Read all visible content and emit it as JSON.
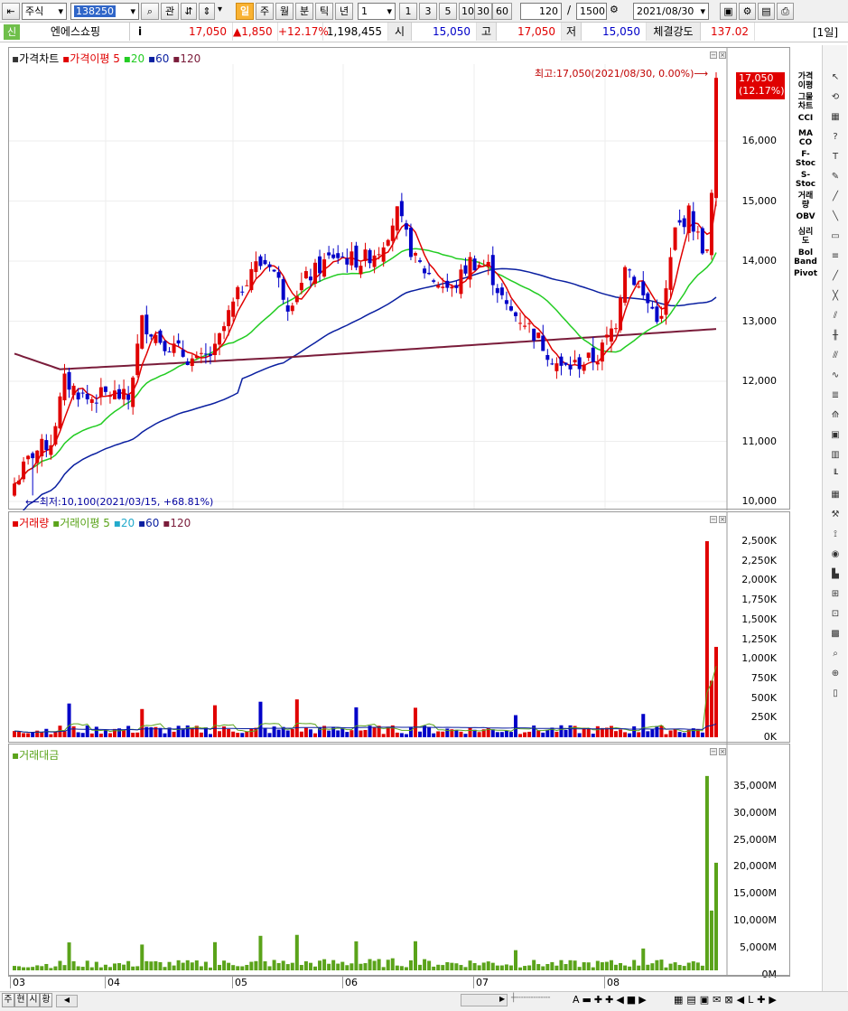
{
  "toolbar": {
    "market": "주식",
    "code": "138250",
    "btn_related": "관",
    "periods": [
      "일",
      "주",
      "월",
      "분",
      "틱",
      "년"
    ],
    "active_period": "일",
    "interval_value": "1",
    "interval_presets": [
      "1",
      "3",
      "5",
      "10",
      "30",
      "60"
    ],
    "display_count": "120",
    "slash": "/",
    "total_count": "1500",
    "date": "2021/08/30"
  },
  "quote": {
    "badge": "신",
    "name": "엔에스쇼핑",
    "info_btn": "i",
    "price": "17,050",
    "change": "▲1,850",
    "change_pct": "+12.17%",
    "volume": "1,198,455",
    "open_label": "시",
    "open": "15,050",
    "high_label": "고",
    "high": "17,050",
    "low_label": "저",
    "low": "15,050",
    "strength_label": "체결강도",
    "strength": "137.02",
    "period_badge": "[1일]"
  },
  "price_pane": {
    "legend": {
      "title": "가격차트",
      "ma_label": "가격이평",
      "ma": [
        "5",
        "20",
        "60",
        "120"
      ]
    },
    "max_note": "최고:17,050(2021/08/30, 0.00%)⟶",
    "min_note": "⟵최저:10,100(2021/03/15, +68.81%)",
    "cur_price": "17,050",
    "cur_pct": "(12.17%)",
    "ticks": [
      "16,000",
      "15,000",
      "14,000",
      "13,000",
      "12,000",
      "11,000",
      "10,000"
    ]
  },
  "volume_pane": {
    "legend": {
      "title": "거래량",
      "ma_label": "거래이평",
      "ma": [
        "5",
        "20",
        "60",
        "120"
      ]
    },
    "ticks": [
      "2,500K",
      "2,250K",
      "2,000K",
      "1,750K",
      "1,500K",
      "1,250K",
      "1,000K",
      "750K",
      "500K",
      "250K",
      "0K"
    ]
  },
  "amount_pane": {
    "legend": {
      "title": "거래대금"
    },
    "ticks": [
      "35,000M",
      "30,000M",
      "25,000M",
      "20,000M",
      "15,000M",
      "10,000M",
      "5,000M",
      "0M"
    ]
  },
  "x_axis": [
    "03",
    "04",
    "05",
    "06",
    "07",
    "08"
  ],
  "left_tools": [
    "가격\n이평",
    "그물\n차트",
    "CCI",
    "MA\nCO",
    "F-\nStoc",
    "S-\nStoc",
    "거래\n량",
    "OBV",
    "심리\n도",
    "Bol\nBand",
    "Pivot"
  ],
  "status_tabs": [
    "주",
    "현",
    "시",
    "황"
  ],
  "colors": {
    "up": "#e00000",
    "down": "#0000c8",
    "ma5": "#e00000",
    "ma20": "#22cc22",
    "ma60": "#0a1fa0",
    "ma120": "#7a1c3a",
    "vol_green": "#5aa31a"
  },
  "chart_data": {
    "type": "candlestick",
    "price": {
      "ylim": [
        10000,
        17050
      ],
      "last": 17050,
      "high": 17050,
      "low": 10100
    },
    "volume_ylim": [
      0,
      2600000
    ],
    "amount_ylim": [
      0,
      40000
    ]
  }
}
